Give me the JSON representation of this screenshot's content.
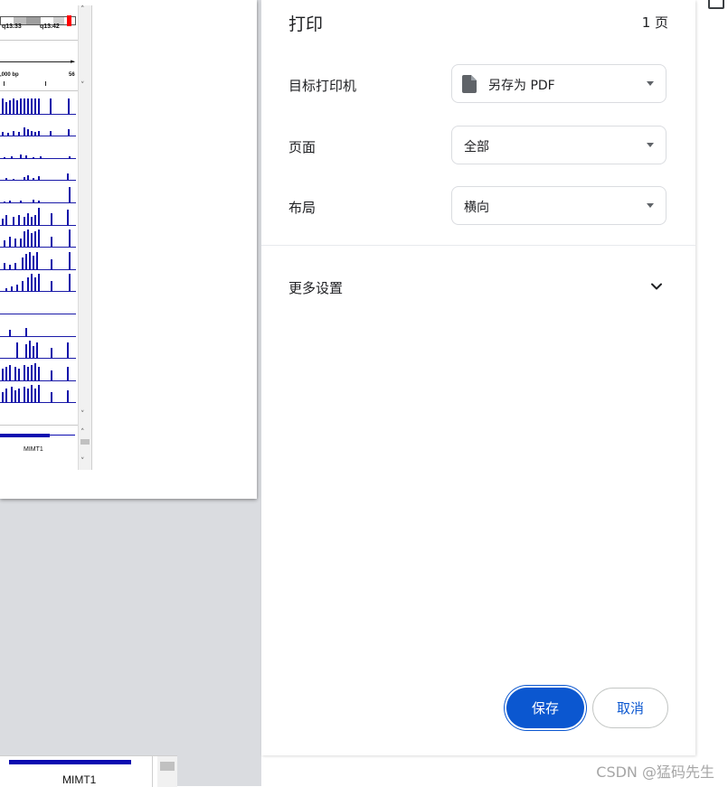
{
  "preview": {
    "cytoband_labels": [
      "q13.33",
      "q13.42"
    ],
    "ruler_labels": [
      ",000 bp",
      "56"
    ],
    "gene_name": "MIMT1"
  },
  "print_panel": {
    "title": "打印",
    "page_count": "1 页",
    "destination": {
      "label": "目标打印机",
      "value": "另存为 PDF",
      "icon": "file-icon"
    },
    "pages": {
      "label": "页面",
      "value": "全部"
    },
    "layout": {
      "label": "布局",
      "value": "横向"
    },
    "more_settings": {
      "label": "更多设置",
      "icon": "chevron-down-icon"
    },
    "buttons": {
      "save": "保存",
      "cancel": "取消"
    },
    "colors": {
      "primary": "#0b57d0",
      "border": "#dadce0",
      "preview_bg": "#dadce0",
      "track_blue": "#1111aa"
    }
  },
  "watermark": "CSDN @猛码先生"
}
